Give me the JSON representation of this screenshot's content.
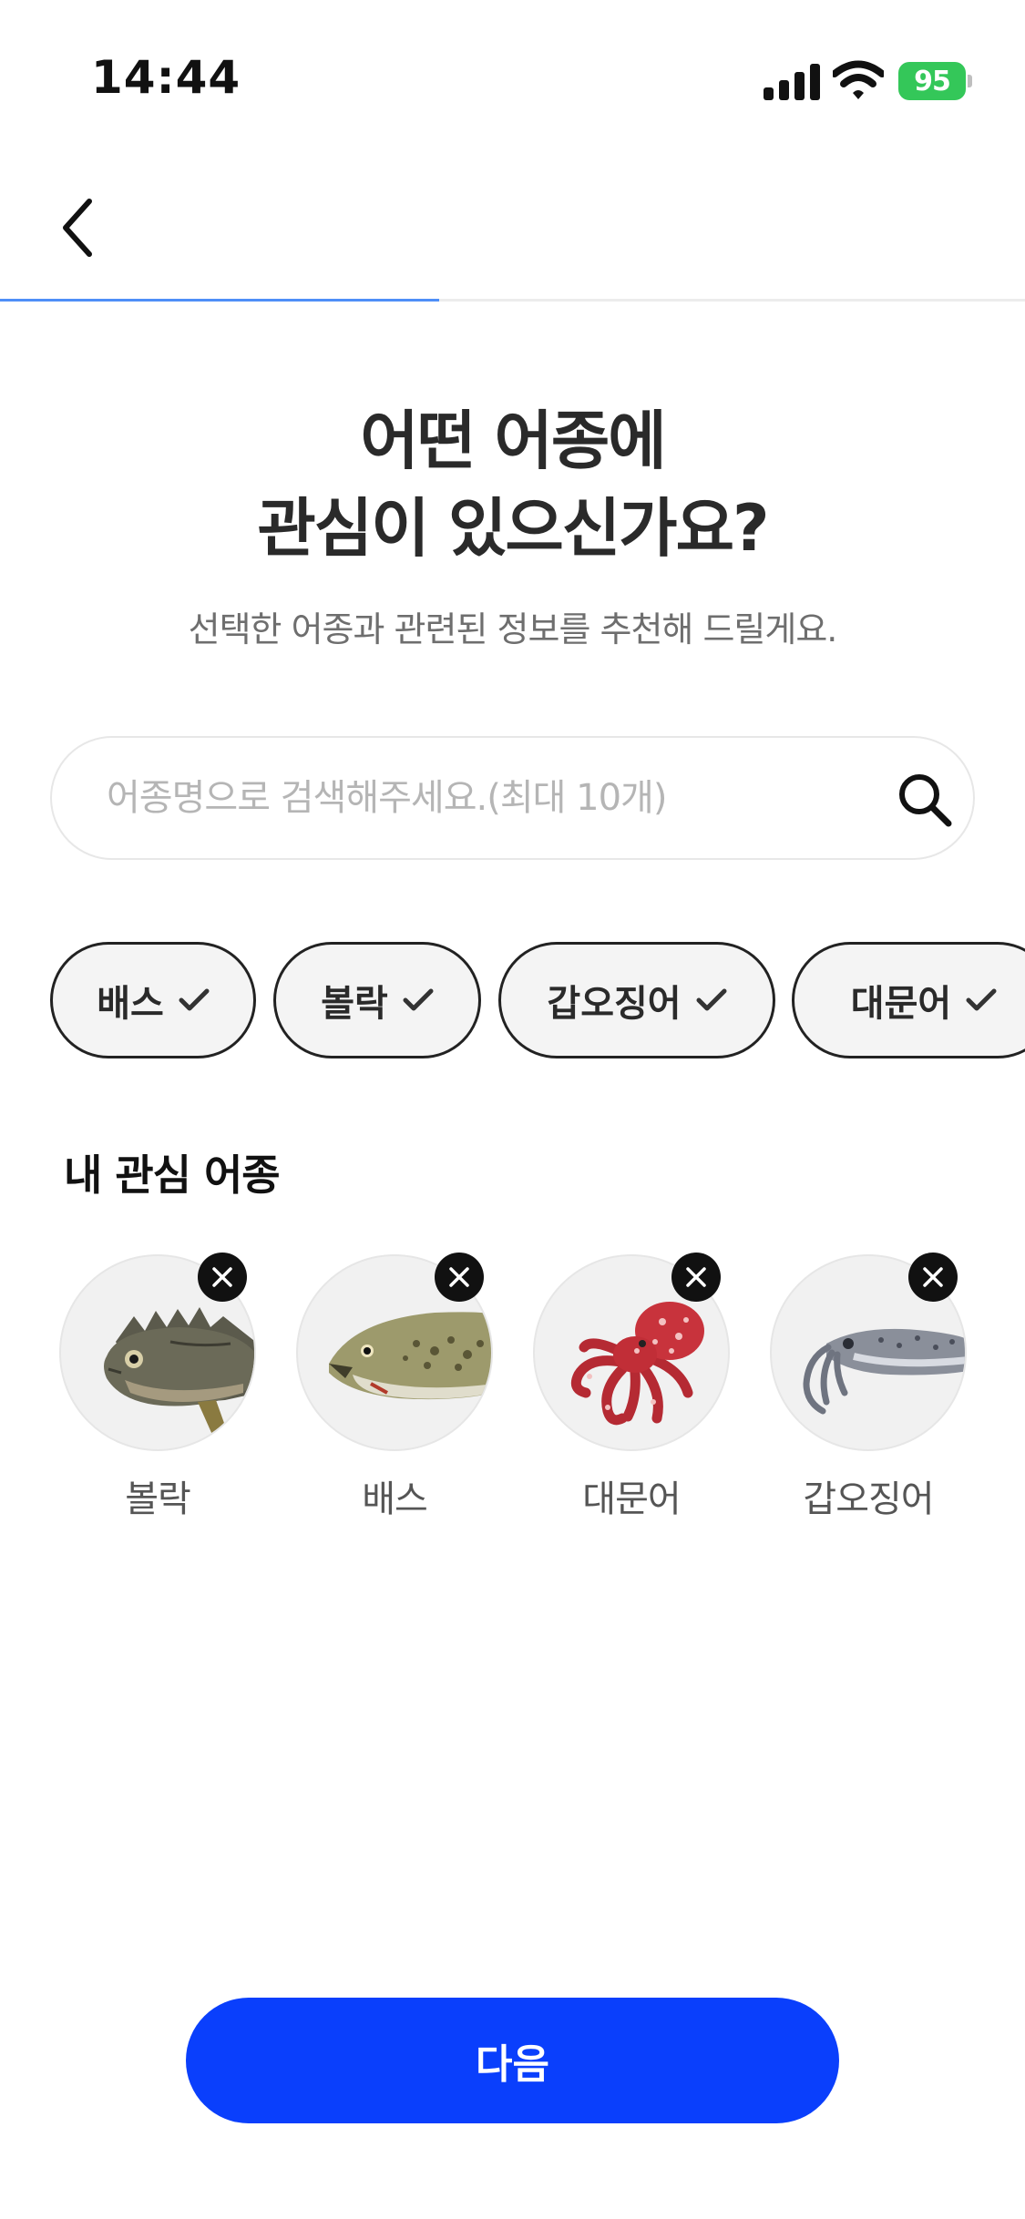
{
  "status_bar": {
    "time": "14:44",
    "battery": "95"
  },
  "nav": {
    "back_icon": "chevron-left-icon"
  },
  "progress": {
    "fraction": 0.5,
    "color": "#4f8ff7"
  },
  "header": {
    "title_line1": "어떤 어종에",
    "title_line2": "관심이 있으신가요?",
    "subtitle": "선택한 어종과 관련된 정보를 추천해 드릴게요."
  },
  "search": {
    "placeholder": "어종명으로 검색해주세요.(최대 10개)",
    "value": "",
    "icon": "search-icon"
  },
  "chips": [
    {
      "label": "배스",
      "selected": true
    },
    {
      "label": "볼락",
      "selected": true
    },
    {
      "label": "갑오징어",
      "selected": true
    },
    {
      "label": "대문어",
      "selected": true
    }
  ],
  "favorites": {
    "title": "내 관심 어종",
    "items": [
      {
        "label": "볼락",
        "image": "rockfish-image"
      },
      {
        "label": "배스",
        "image": "bass-image"
      },
      {
        "label": "대문어",
        "image": "octopus-image"
      },
      {
        "label": "갑오징어",
        "image": "cuttlefish-image"
      }
    ]
  },
  "footer": {
    "next_label": "다음"
  },
  "colors": {
    "accent": "#0a3ffc",
    "battery": "#34c759"
  }
}
